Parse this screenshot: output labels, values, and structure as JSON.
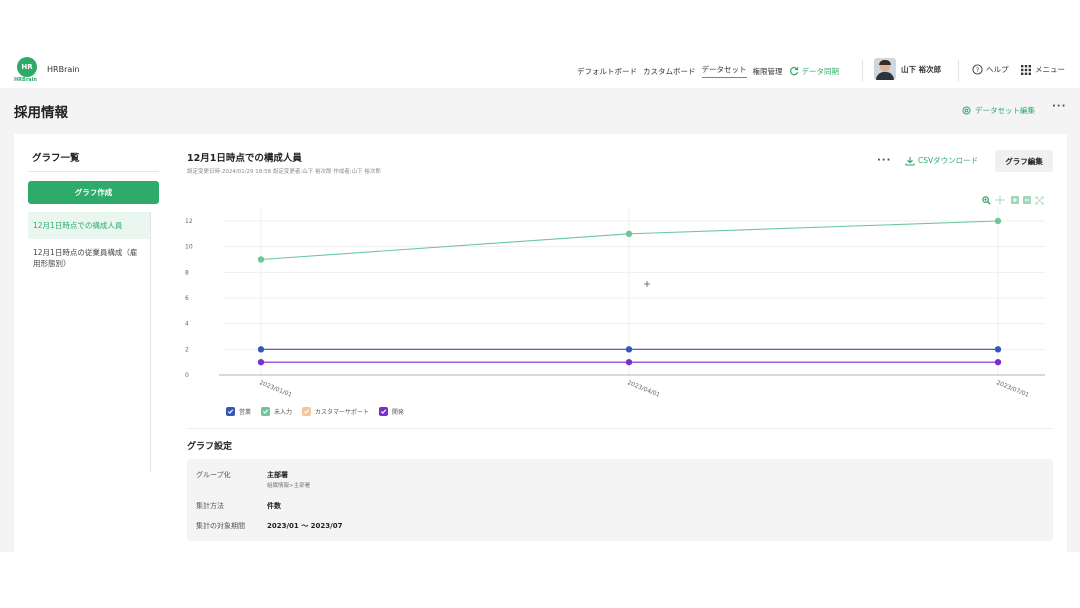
{
  "header": {
    "logo_text": "HR",
    "logo_sub": "HRBrain",
    "app_name": "HRBrain",
    "nav": [
      "デフォルトボード",
      "カスタムボード",
      "データセット",
      "権限管理"
    ],
    "nav_active": "データセット",
    "sync_label": "データ同期",
    "user_name": "山下 裕次郎",
    "help_label": "ヘルプ",
    "menu_label": "メニュー"
  },
  "page": {
    "title": "採用情報",
    "dataset_edit_label": "データセット編集",
    "more_label": "···"
  },
  "sidebar": {
    "title": "グラフ一覧",
    "create_label": "グラフ作成",
    "items": [
      {
        "label": "12月1日時点での構成人員",
        "selected": true
      },
      {
        "label": "12月1日時点の従業員構成（雇用形態別）",
        "selected": false
      }
    ]
  },
  "graph": {
    "title": "12月1日時点での構成人員",
    "meta": "設定変更日時:2024/01/29 18:58  設定変更者:山下 裕次郎  作成者:山下 裕次郎",
    "more_label": "···",
    "csv_label": "CSVダウンロード",
    "edit_label": "グラフ編集"
  },
  "chart_data": {
    "type": "line",
    "x": [
      "2023/01/01",
      "2023/04/01",
      "2023/07/01"
    ],
    "ylim": [
      0,
      12
    ],
    "yticks": [
      0,
      2,
      4,
      6,
      8,
      10,
      12
    ],
    "grid": true,
    "legend_position": "bottom-left",
    "series": [
      {
        "name": "営業",
        "color": "#3457b8",
        "values": [
          2,
          2,
          2
        ]
      },
      {
        "name": "未入力",
        "color": "#6cc79b",
        "values": [
          9,
          11,
          12
        ]
      },
      {
        "name": "カスタマーサポート",
        "color": "#f2c89a",
        "values": [
          null,
          null,
          null
        ]
      },
      {
        "name": "開発",
        "color": "#7a2fd0",
        "values": [
          1,
          1,
          1
        ]
      }
    ]
  },
  "settings": {
    "title": "グラフ設定",
    "group_label": "グループ化",
    "group_value": "主部署",
    "group_sub": "組織情報>主部署",
    "agg_label": "集計方法",
    "agg_value": "件数",
    "period_label": "集計の対象期間",
    "period_value": "2023/01 〜 2023/07"
  }
}
